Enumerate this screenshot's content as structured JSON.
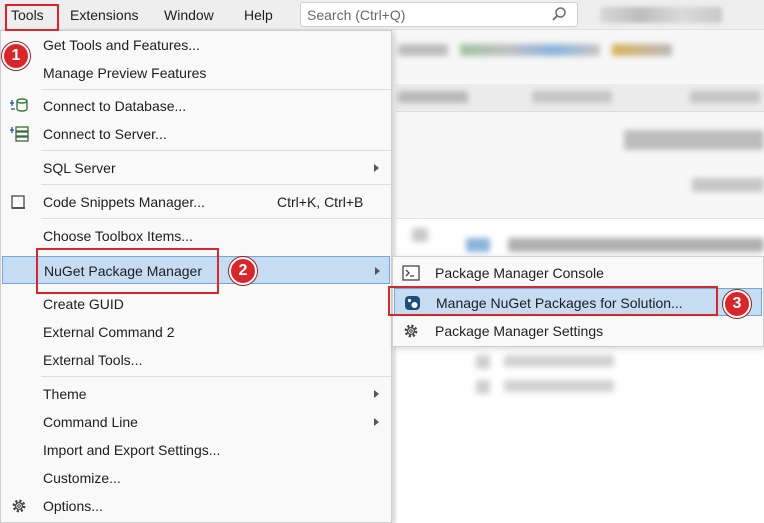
{
  "menubar": {
    "items": [
      "Tools",
      "Extensions",
      "Window",
      "Help"
    ],
    "search_placeholder": "Search (Ctrl+Q)"
  },
  "tools_menu": {
    "items": [
      {
        "label": "Get Tools and Features...",
        "icon": "none"
      },
      {
        "label": "Manage Preview Features",
        "icon": "none"
      },
      {
        "label": "Connect to Database...",
        "icon": "database-connect-icon"
      },
      {
        "label": "Connect to Server...",
        "icon": "server-connect-icon"
      },
      {
        "label": "SQL Server",
        "submenu": true
      },
      {
        "label": "Code Snippets Manager...",
        "shortcut": "Ctrl+K, Ctrl+B",
        "icon": "code-snippets-icon"
      },
      {
        "label": "Choose Toolbox Items..."
      },
      {
        "label": "NuGet Package Manager",
        "submenu": true,
        "highlighted": true
      },
      {
        "label": "Create GUID"
      },
      {
        "label": "External Command 2"
      },
      {
        "label": "External Tools..."
      },
      {
        "label": "Theme",
        "submenu": true
      },
      {
        "label": "Command Line",
        "submenu": true
      },
      {
        "label": "Import and Export Settings..."
      },
      {
        "label": "Customize..."
      },
      {
        "label": "Options...",
        "icon": "gear-icon"
      }
    ]
  },
  "nuget_submenu": {
    "items": [
      {
        "label": "Package Manager Console",
        "icon": "console-icon"
      },
      {
        "label": "Manage NuGet Packages for Solution...",
        "icon": "nuget-icon",
        "highlighted": true
      },
      {
        "label": "Package Manager Settings",
        "icon": "gear-icon"
      }
    ]
  },
  "annotations": {
    "steps": [
      "1",
      "2",
      "3"
    ],
    "color": "#d9262b"
  },
  "colors": {
    "highlight": "#c5dcf2",
    "highlight_border": "#6fa6dd",
    "menu_bg": "#f9f9f9"
  }
}
